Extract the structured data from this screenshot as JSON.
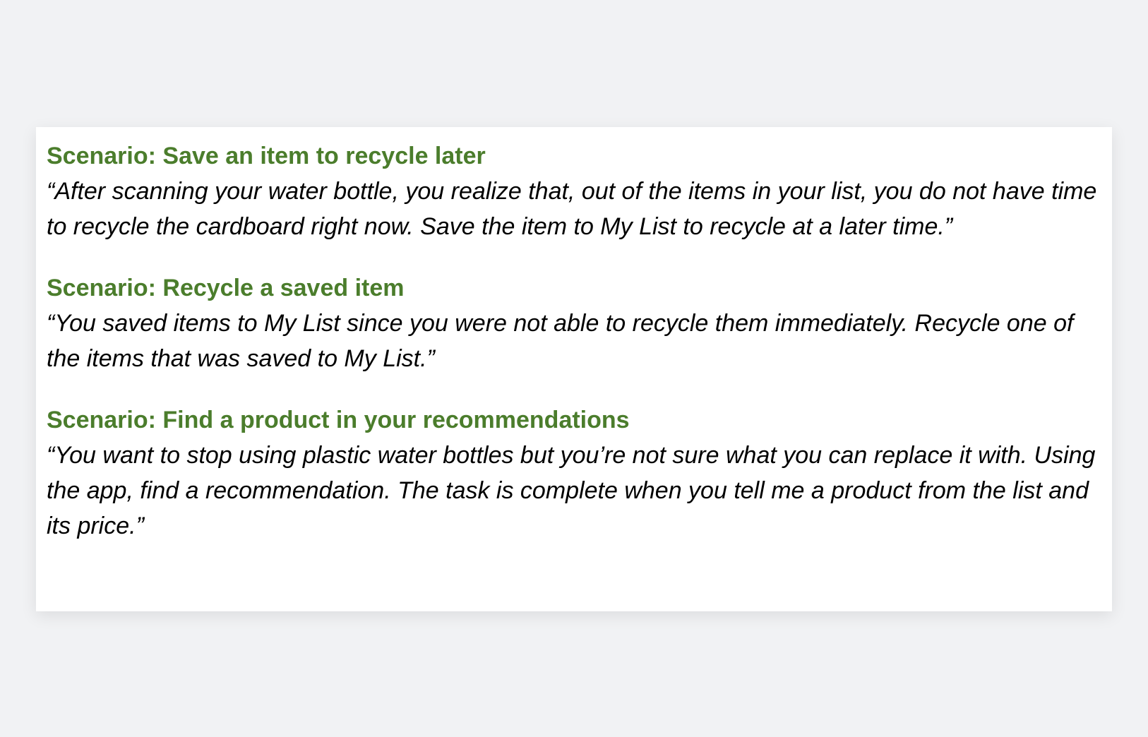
{
  "scenarios": [
    {
      "title": "Scenario: Save an item to recycle later",
      "body": "“After scanning your water bottle, you realize that, out of the items in your list, you do not have time to recycle the cardboard right now. Save the item to My List to recycle at a later time.”"
    },
    {
      "title": "Scenario: Recycle a saved item",
      "body": "“You saved items to My List since you were not able to recycle them immediately. Recycle one of the items that was saved to My List.”"
    },
    {
      "title": "Scenario: Find a product in your recommendations",
      "body": "“You want to stop using plastic water bottles but you’re not sure what you can replace it with. Using the app, find a recommendation. The task is complete when you tell me a product from the list and its price.”"
    }
  ],
  "colors": {
    "title": "#4b7d2c",
    "body": "#000000",
    "background": "#f1f2f4",
    "card": "#ffffff"
  }
}
